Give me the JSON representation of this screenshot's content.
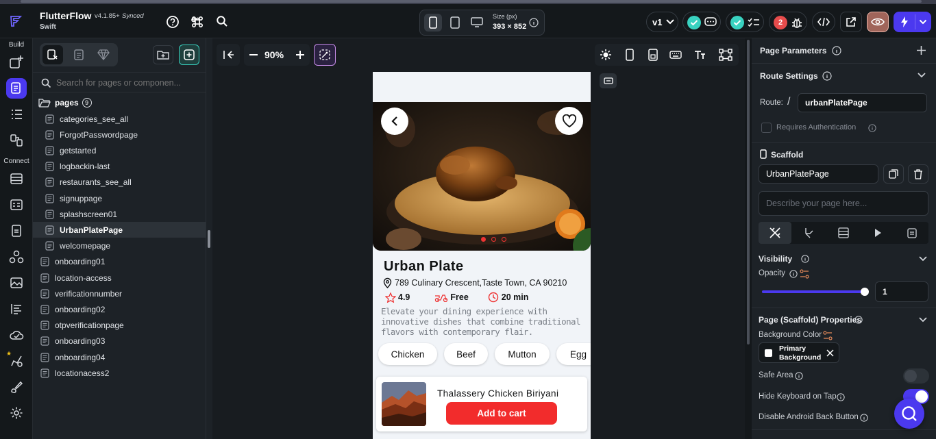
{
  "app": {
    "name": "FlutterFlow",
    "version": "v4.1.85+",
    "sync_status": "Synced",
    "project": "Swift"
  },
  "device": {
    "size_label": "Size (px)",
    "size_value": "393 × 852"
  },
  "topbar": {
    "branch": "v1",
    "notification_count": "2"
  },
  "rail": {
    "build_label": "Build",
    "connect_label": "Connect"
  },
  "left_panel": {
    "search_placeholder": "Search for pages or componen...",
    "folder_label": "pages",
    "folder_count": "9",
    "folder_pages": [
      "categories_see_all",
      "ForgotPasswordpage",
      "getstarted",
      "logbackin-last",
      "restaurants_see_all",
      "signuppage",
      "splashscreen01",
      "UrbanPlatePage",
      "welcomepage"
    ],
    "root_pages": [
      "onboarding01",
      "location-access",
      "verificationnumber",
      "onboarding02",
      "otpverificationpage",
      "onboarding03",
      "onboarding04",
      "locationacess2"
    ],
    "selected_page": "UrbanPlatePage"
  },
  "canvas_toolbar": {
    "zoom": "90%"
  },
  "phone": {
    "title": "Urban Plate",
    "address": "789 Culinary Crescent,Taste Town, CA 90210",
    "rating": "4.9",
    "delivery": "Free",
    "time": "20 min",
    "description": "Elevate your dining experience with innovative dishes that combine traditional flavors with contemporary flair.",
    "chips": [
      "Chicken",
      "Beef",
      "Mutton",
      "Egg"
    ],
    "card_title": "Thalassery Chicken Biriyani",
    "card_button": "Add to cart"
  },
  "right_panel": {
    "page_parameters": "Page Parameters",
    "route_settings": "Route Settings",
    "route_label": "Route:",
    "route_slash": "/",
    "route_value": "urbanPlatePage",
    "requires_auth": "Requires Authentication",
    "scaffold_label": "Scaffold",
    "page_name": "UrbanPlatePage",
    "describe_placeholder": "Describe your page here...",
    "visibility": "Visibility",
    "opacity_label": "Opacity",
    "opacity_value": "1",
    "opacity_fraction": 1.0,
    "scaffold_props": "Page (Scaffold) Properties",
    "bg_color_label": "Background Color",
    "bg_color_line1": "Primary",
    "bg_color_line2": "Background",
    "safe_area": "Safe Area",
    "hide_keyboard": "Hide Keyboard on Tap",
    "disable_back": "Disable Android Back Button"
  },
  "colors": {
    "accent": "#4b39ef",
    "teal": "#39d2c0",
    "red": "#e74c4c",
    "cart": "#f22c2c",
    "preview": "#a0655a"
  }
}
